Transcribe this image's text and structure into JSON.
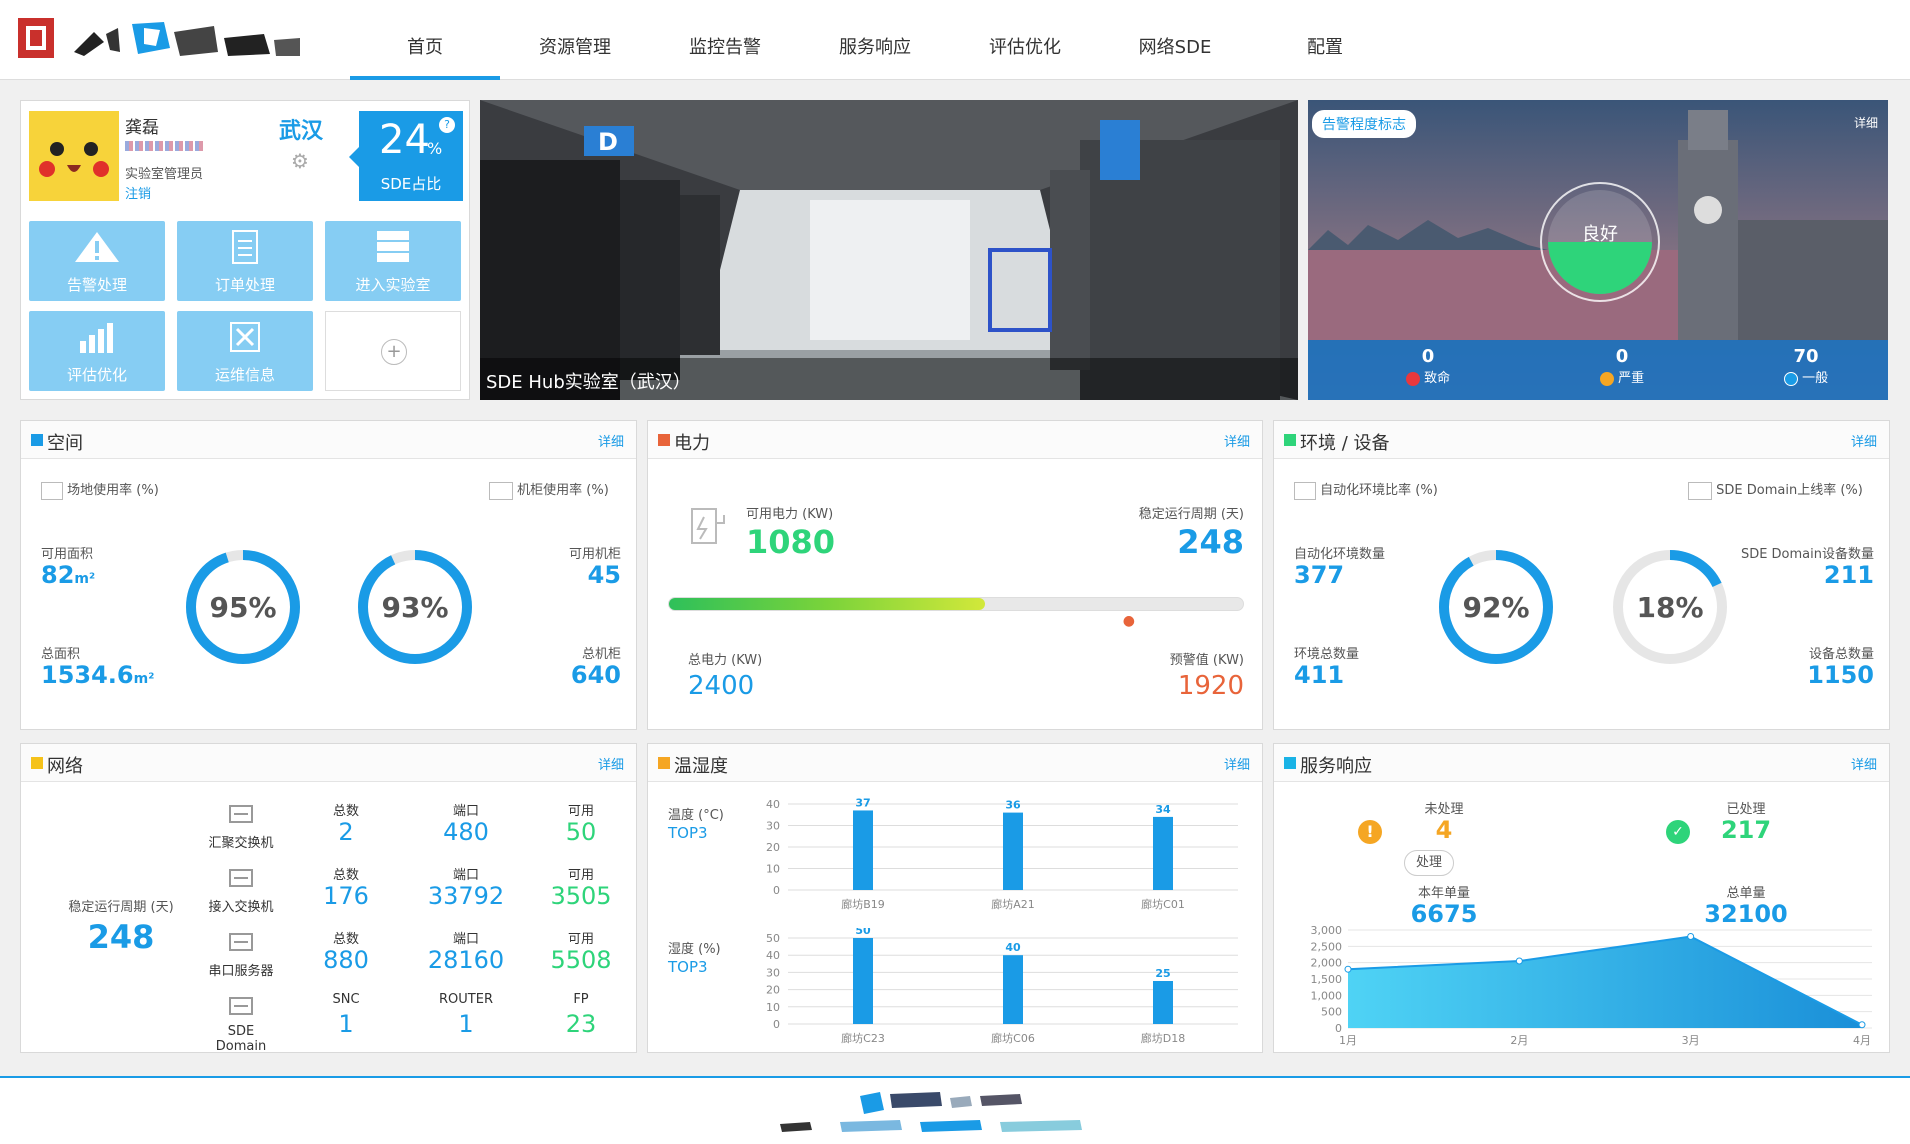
{
  "nav": [
    "首页",
    "资源管理",
    "监控告警",
    "服务响应",
    "评估优化",
    "网络SDE",
    "配置"
  ],
  "user": {
    "name": "龚磊",
    "role": "实验室管理员",
    "logout": "注销",
    "city": "武汉",
    "sde_pct": "24",
    "pct_sign": "%",
    "sde_label": "SDE占比",
    "help": "?"
  },
  "tiles": [
    "告警处理",
    "订单处理",
    "进入实验室",
    "评估优化",
    "运维信息"
  ],
  "add_icon": "plus-icon",
  "lab_caption": "SDE Hub实验室（武汉）",
  "alarm": {
    "tag": "告警程度标志",
    "detail": "详细",
    "status": "良好",
    "items": [
      {
        "count": "0",
        "label": "致命",
        "color": "#e8383d"
      },
      {
        "count": "0",
        "label": "严重",
        "color": "#f5a623"
      },
      {
        "count": "70",
        "label": "一般",
        "color": "#1a9be6"
      }
    ]
  },
  "space": {
    "title": "空间",
    "detail": "详细",
    "site_rate": "场地使用率 (%)",
    "cab_rate": "机柜使用率 (%)",
    "avail_area_label": "可用面积",
    "avail_area": "82",
    "unit": "m²",
    "total_area_label": "总面积",
    "total_area": "1534.6",
    "site_pct": 95,
    "site_pct_text": "95%",
    "cab_pct": 93,
    "cab_pct_text": "93%",
    "avail_cab_label": "可用机柜",
    "avail_cab": "45",
    "total_cab_label": "总机柜",
    "total_cab": "640"
  },
  "power": {
    "title": "电力",
    "detail": "详细",
    "avail_label": "可用电力 (KW)",
    "avail": "1080",
    "stable_label": "稳定运行周期 (天)",
    "stable": "248",
    "total_label": "总电力 (KW)",
    "total": "2400",
    "warn_label": "预警值 (KW)",
    "warn": "1920",
    "usage_fraction": 0.55,
    "warn_fraction": 0.8
  },
  "env": {
    "title": "环境 / 设备",
    "detail": "详细",
    "auto_rate": "自动化环境比率 (%)",
    "domain_rate": "SDE Domain上线率 (%)",
    "auto_count_label": "自动化环境数量",
    "auto_count": "377",
    "env_total_label": "环境总数量",
    "env_total": "411",
    "auto_pct": 92,
    "auto_pct_text": "92%",
    "domain_pct": 18,
    "domain_pct_text": "18%",
    "domain_count_label": "SDE Domain设备数量",
    "domain_count": "211",
    "dev_total_label": "设备总数量",
    "dev_total": "1150"
  },
  "network": {
    "title": "网络",
    "detail": "详细",
    "stable_label": "稳定运行周期 (天)",
    "stable": "248",
    "rows": [
      {
        "name": "汇聚交换机",
        "h1": "总数",
        "v1": "2",
        "h2": "端口",
        "v2": "480",
        "h3": "可用",
        "v3": "50"
      },
      {
        "name": "接入交换机",
        "h1": "总数",
        "v1": "176",
        "h2": "端口",
        "v2": "33792",
        "h3": "可用",
        "v3": "3505"
      },
      {
        "name": "串口服务器",
        "h1": "总数",
        "v1": "880",
        "h2": "端口",
        "v2": "28160",
        "h3": "可用",
        "v3": "5508"
      },
      {
        "name": "SDE Domain",
        "h1": "SNC",
        "v1": "1",
        "h2": "ROUTER",
        "v2": "1",
        "h3": "FP",
        "v3": "23"
      }
    ]
  },
  "temp": {
    "title": "温湿度",
    "detail": "详细",
    "t_label": "温度 (°C)",
    "t_top": "TOP3",
    "h_label": "湿度 (%)",
    "h_top": "TOP3"
  },
  "service": {
    "title": "服务响应",
    "detail": "详细",
    "pending_label": "未处理",
    "pending": "4",
    "done_label": "已处理",
    "done": "217",
    "handle": "处理",
    "year_label": "本年单量",
    "year": "6675",
    "total_label": "总单量",
    "total": "32100"
  },
  "chart_data": [
    {
      "type": "bar",
      "title": "温度 (°C) TOP3",
      "categories": [
        "廊坊B19",
        "廊坊A21",
        "廊坊C01"
      ],
      "values": [
        37,
        36,
        34
      ],
      "ylim": [
        0,
        40
      ],
      "ticks": [
        40,
        30,
        20,
        10,
        0
      ]
    },
    {
      "type": "bar",
      "title": "湿度 (%) TOP3",
      "categories": [
        "廊坊C23",
        "廊坊C06",
        "廊坊D18"
      ],
      "values": [
        50,
        40,
        25
      ],
      "ylim": [
        0,
        50
      ],
      "ticks": [
        50,
        40,
        30,
        20,
        10,
        0
      ]
    },
    {
      "type": "area",
      "categories": [
        "1月",
        "2月",
        "3月",
        "4月"
      ],
      "values": [
        1800,
        2050,
        2800,
        100
      ],
      "ylim": [
        0,
        3000
      ],
      "ticks": [
        "3,000",
        "2,500",
        "2,000",
        "1,500",
        "1,000",
        "500",
        "0"
      ]
    }
  ]
}
